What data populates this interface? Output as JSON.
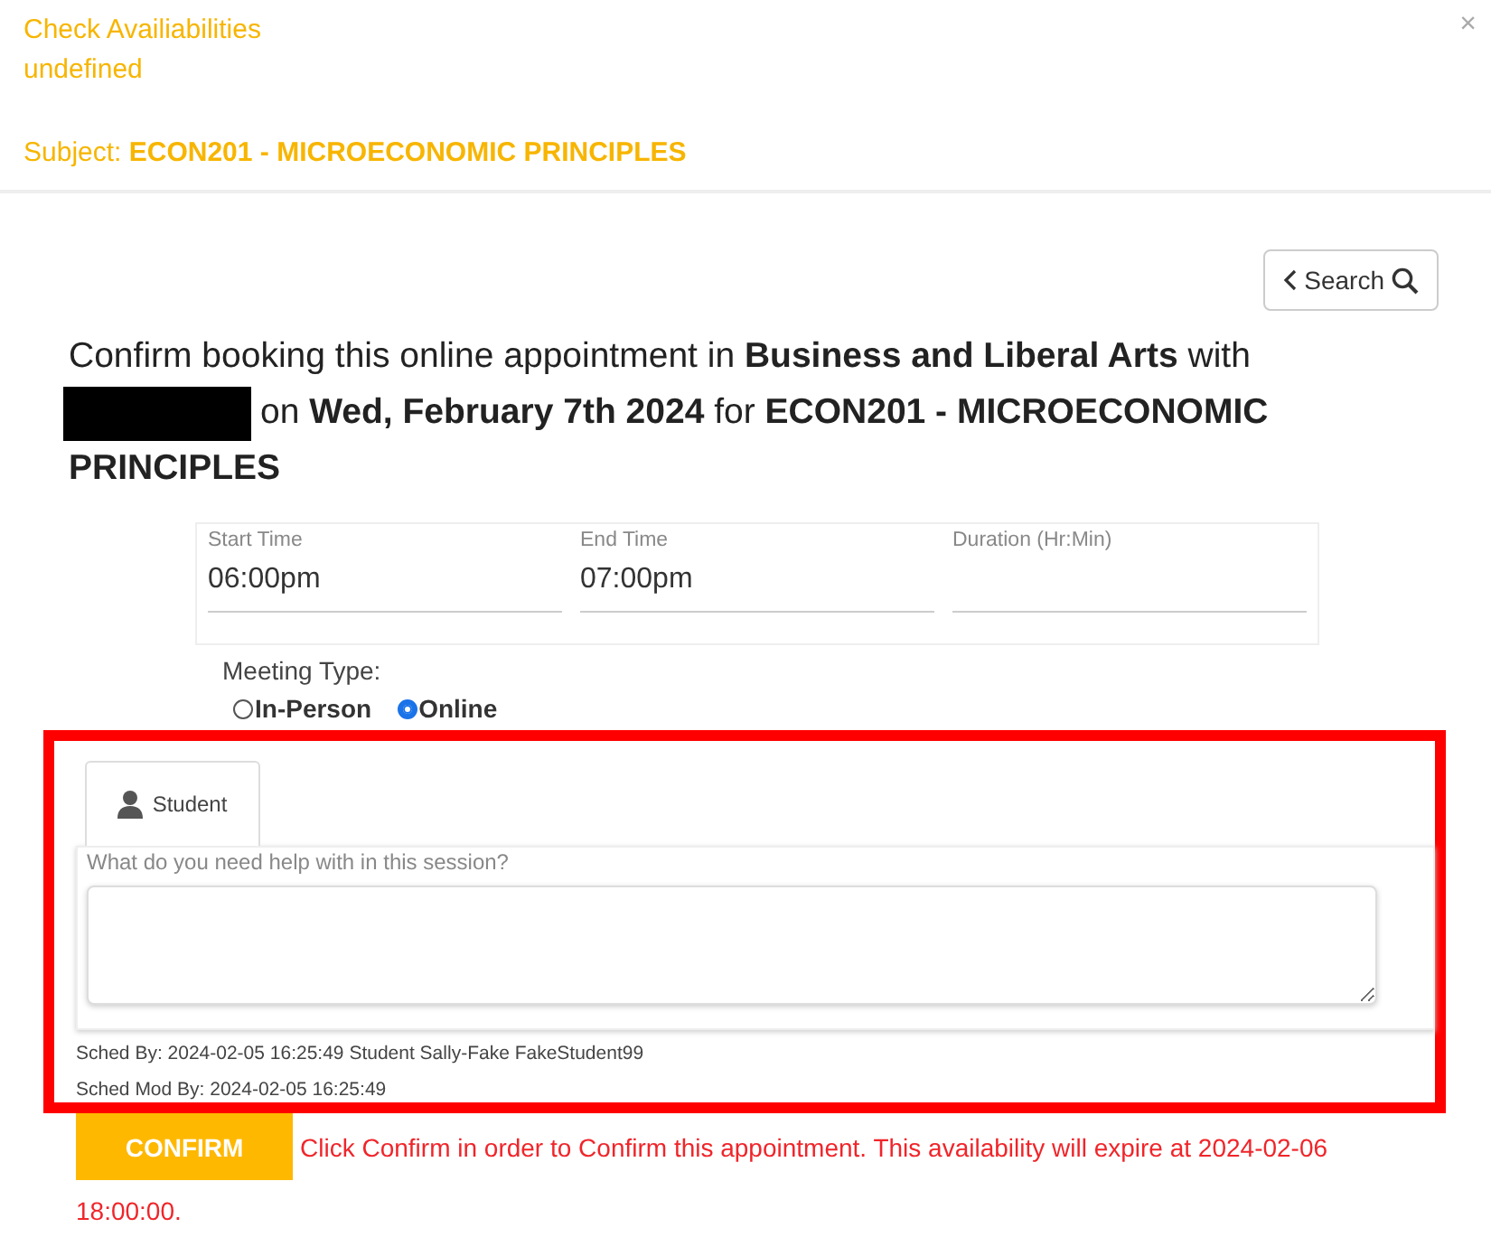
{
  "header": {
    "title": "Check Availiabilities",
    "subtitle": "undefined",
    "subject_label": "Subject:",
    "subject": "ECON201 - MICROECONOMIC PRINCIPLES",
    "close": "×"
  },
  "search_button": {
    "label": "Search"
  },
  "heading": {
    "before": "Confirm booking this online appointment in **Business and Liberal Arts** with",
    "redacted": true,
    "after": "on **Wed, February 7th 2024** for **ECON201 - MICROECONOMIC**",
    "last": "PRINCIPLES"
  },
  "time_fields": [
    {
      "label": "Start Time",
      "value": "06:00pm"
    },
    {
      "label": "End Time",
      "value": "07:00pm"
    },
    {
      "label": "Duration (Hr:Min)"
    }
  ],
  "meeting_type": {
    "label": "Meeting Type:",
    "options": [
      {
        "label": "In-Person",
        "selected": false
      },
      {
        "label": "Online",
        "selected": true
      }
    ]
  },
  "notes": {
    "tabs": [
      {
        "label": "Student",
        "selected": true
      }
    ],
    "prompt": "What do you need help with in this session?",
    "highlighted": true
  },
  "sched_by": "Sched By: 2024-02-05 16:25:49 Student Sally-Fake FakeStudent99",
  "sched_mod_by": "Sched Mod By: 2024-02-05 16:25:49",
  "confirm_button": {
    "label": "CONFIRM"
  },
  "message": [
    "Click Confirm in order to Confirm this appointment. This availability will expire at 2024-02-06",
    "18:00:00."
  ]
}
